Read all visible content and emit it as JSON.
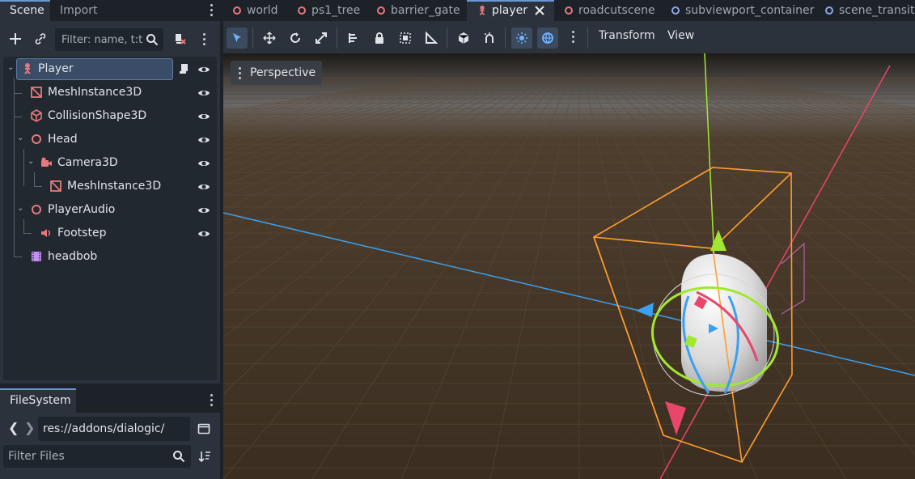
{
  "left_dock": {
    "tabs": [
      "Scene",
      "Import"
    ],
    "filter_placeholder": "Filter: name, t:t",
    "tree": [
      {
        "label": "Player",
        "icon": "player-node-icon"
      },
      {
        "label": "MeshInstance3D",
        "icon": "mesh-instance-icon"
      },
      {
        "label": "CollisionShape3D",
        "icon": "collision-shape-icon"
      },
      {
        "label": "Head",
        "icon": "node3d-icon"
      },
      {
        "label": "Camera3D",
        "icon": "camera-icon"
      },
      {
        "label": "MeshInstance3D",
        "icon": "mesh-instance-icon"
      },
      {
        "label": "PlayerAudio",
        "icon": "node3d-icon"
      },
      {
        "label": "Footstep",
        "icon": "audio-player-icon"
      },
      {
        "label": "headbob",
        "icon": "animation-player-icon"
      }
    ]
  },
  "filesystem": {
    "tab": "FileSystem",
    "path": "res://addons/dialogic/",
    "filter_placeholder": "Filter Files"
  },
  "editor_tabs": [
    {
      "label": "world",
      "color": "#e8787a"
    },
    {
      "label": "ps1_tree",
      "color": "#e8787a"
    },
    {
      "label": "barrier_gate",
      "color": "#e8787a"
    },
    {
      "label": "player",
      "color": "#e8787a"
    },
    {
      "label": "roadcutscene",
      "color": "#e8787a"
    },
    {
      "label": "subviewport_container",
      "color": "#8ea6e8"
    },
    {
      "label": "scene_transiti",
      "color": "#8ea6e8"
    }
  ],
  "viewport_toolbar": {
    "transform_menu": "Transform",
    "view_menu": "View"
  },
  "viewport": {
    "perspective_label": "Perspective"
  },
  "colors": {
    "accent": "#6b97d6",
    "x_axis": "#e8466a",
    "y_axis": "#a0e832",
    "z_axis": "#3ba0f0",
    "selection": "#ff9d2e"
  }
}
